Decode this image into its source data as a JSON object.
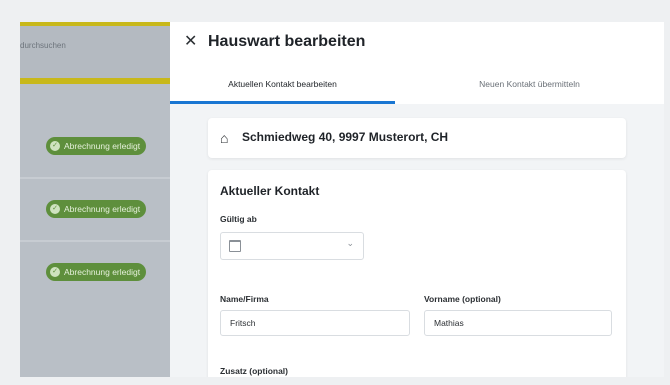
{
  "backdrop": {
    "search_text": "durchsuchen",
    "badges": [
      "Abrechnung erledigt",
      "Abrechnung erledigt",
      "Abrechnung erledigt"
    ]
  },
  "drawer": {
    "close_icon": "close-icon",
    "title": "Hauswart bearbeiten",
    "tabs": [
      {
        "label": "Aktuellen Kontakt bearbeiten",
        "active": true
      },
      {
        "label": "Neuen Kontakt übermitteln",
        "active": false
      }
    ],
    "address": "Schmiedweg 40, 9997 Musterort, CH",
    "contact": {
      "heading": "Aktueller Kontakt",
      "valid_from_label": "Gültig ab",
      "valid_from_value": "",
      "name_label": "Name/Firma",
      "name_value": "Fritsch",
      "firstname_label": "Vorname (optional)",
      "firstname_value": "Mathias",
      "extra_label": "Zusatz (optional)"
    }
  },
  "colors": {
    "accent": "#1976d2",
    "badge_green": "#5e8f3c",
    "highlight_yellow": "#c8b81a"
  }
}
